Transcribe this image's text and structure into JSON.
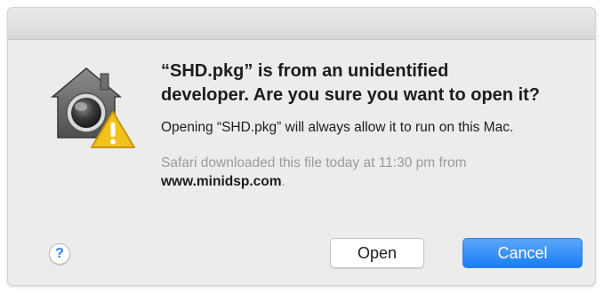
{
  "dialog": {
    "headline_line1": "“SHD.pkg” is from an unidentified",
    "headline_line2": "developer. Are you sure you want to open it?",
    "body": "Opening “SHD.pkg” will always allow it to run on this Mac.",
    "source_prefix": "Safari downloaded this file today at 11:30 pm from",
    "source_domain": "www.minidsp.com",
    "source_suffix": "."
  },
  "buttons": {
    "help_label": "?",
    "open_label": "Open",
    "cancel_label": "Cancel"
  },
  "icons": {
    "security": "gatekeeper-security-icon",
    "warning": "warning-icon"
  },
  "colors": {
    "accent": "#1a7df4",
    "warning": "#f3c21a"
  }
}
